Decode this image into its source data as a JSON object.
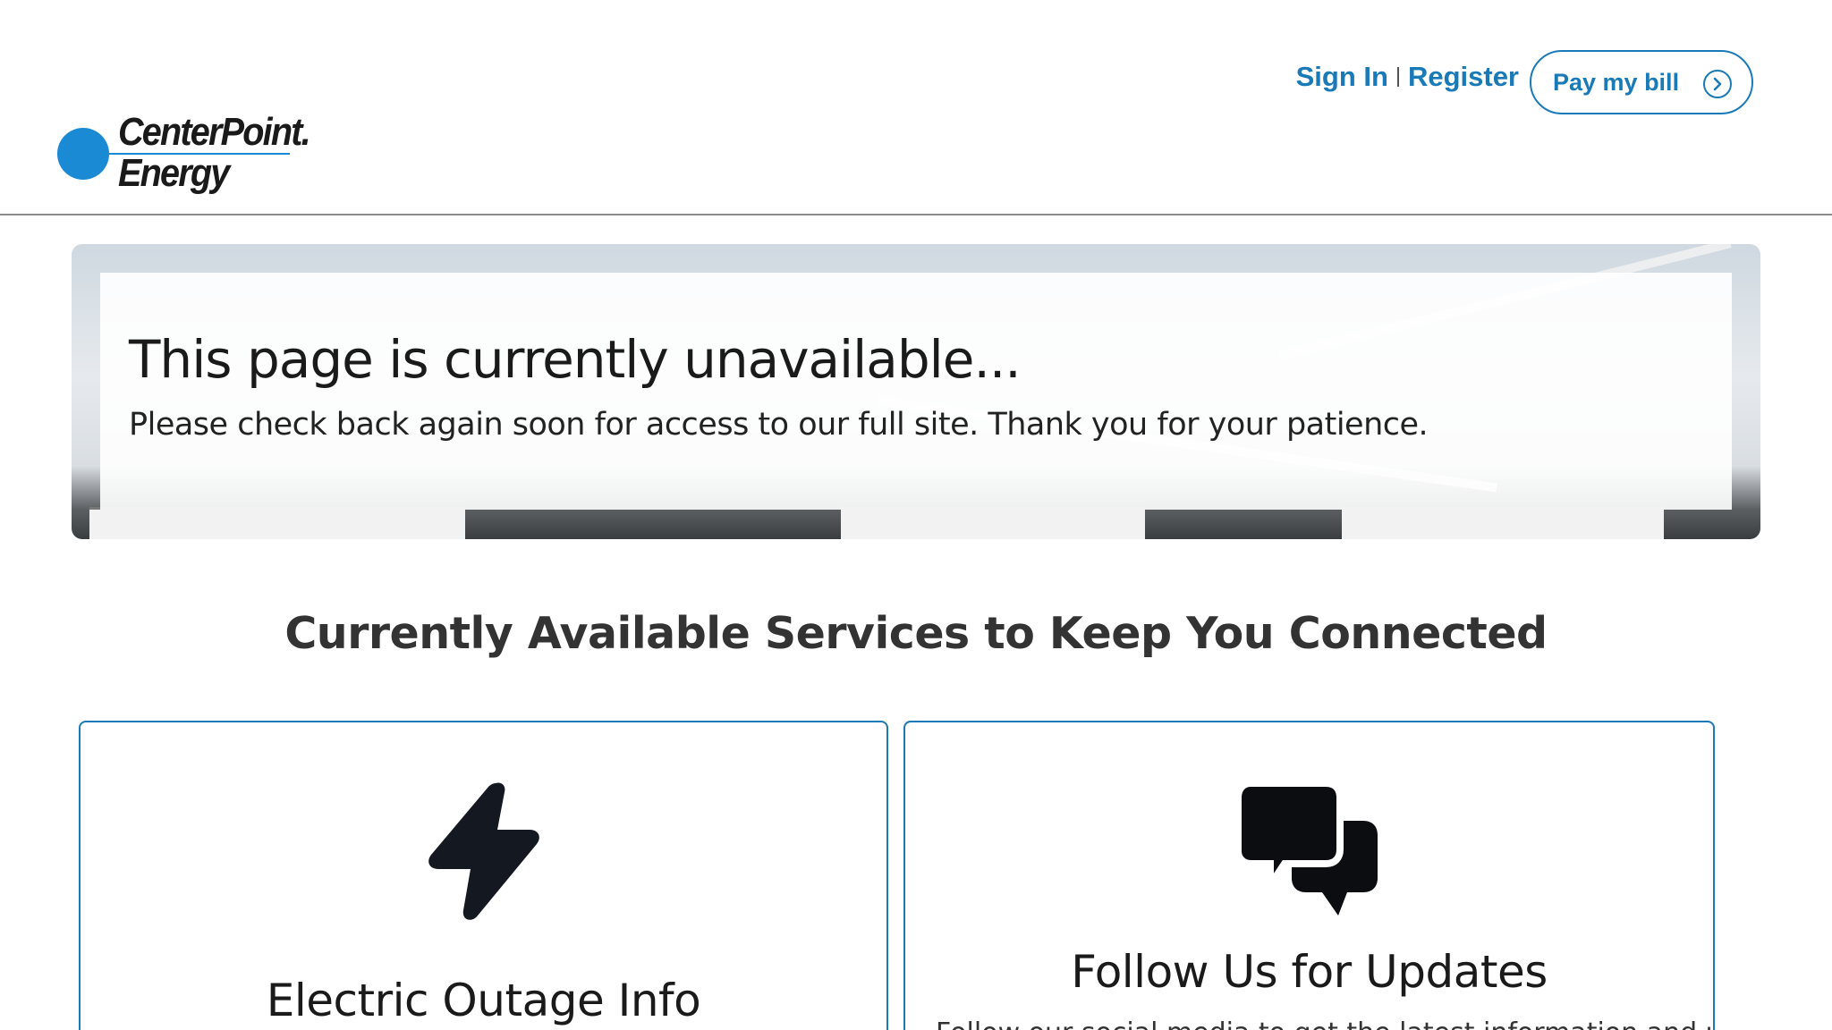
{
  "header": {
    "logo": {
      "line1": "CenterPoint.",
      "line2": "Energy"
    },
    "sign_in": "Sign In",
    "register": "Register",
    "pay_bill": "Pay my bill"
  },
  "hero": {
    "title": "This page is currently unavailable...",
    "subtitle": "Please check back again soon for access to our full site. Thank you for your patience."
  },
  "services": {
    "heading": "Currently Available Services to Keep You Connected",
    "cards": [
      {
        "title": "Electric Outage Info",
        "icon": "lightning-bolt-icon"
      },
      {
        "title": "Follow Us for Updates",
        "icon": "chat-bubbles-icon",
        "description": "Follow our social media to get the latest information and updates."
      }
    ]
  },
  "colors": {
    "brand_blue": "#1a7ab8",
    "logo_blue": "#1a8ad4"
  }
}
